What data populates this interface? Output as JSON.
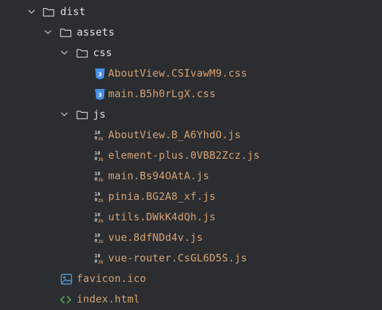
{
  "tree": {
    "dist": {
      "label": "dist",
      "icon": "folder-icon",
      "expanded": true
    },
    "assets": {
      "label": "assets",
      "icon": "folder-icon",
      "expanded": true
    },
    "css_folder": {
      "label": "css",
      "icon": "folder-icon",
      "expanded": true
    },
    "css_files": [
      {
        "label": "AboutView.CSIvawM9.css",
        "icon": "css-file-icon"
      },
      {
        "label": "main.B5h0rLgX.css",
        "icon": "css-file-icon"
      }
    ],
    "js_folder": {
      "label": "js",
      "icon": "folder-icon",
      "expanded": true
    },
    "js_files": [
      {
        "label": "AboutView.B_A6YhdO.js",
        "icon": "js-file-icon"
      },
      {
        "label": "element-plus.0VBB2Zcz.js",
        "icon": "js-file-icon"
      },
      {
        "label": "main.Bs94OAtA.js",
        "icon": "js-file-icon"
      },
      {
        "label": "pinia.BG2A8_xf.js",
        "icon": "js-file-icon"
      },
      {
        "label": "utils.DWkK4dQh.js",
        "icon": "js-file-icon"
      },
      {
        "label": "vue.8dfNDd4v.js",
        "icon": "js-file-icon"
      },
      {
        "label": "vue-router.CsGL6D5S.js",
        "icon": "js-file-icon"
      }
    ],
    "favicon": {
      "label": "favicon.ico",
      "icon": "image-file-icon"
    },
    "index": {
      "label": "index.html",
      "icon": "html-file-icon"
    }
  },
  "colors": {
    "background": "#2b2d30",
    "folder_label": "#dfe1e5",
    "file_label": "#d5a274",
    "css_icon": "#4a8ee6",
    "html_icon": "#57a65b",
    "image_icon": "#5b9bd5"
  }
}
